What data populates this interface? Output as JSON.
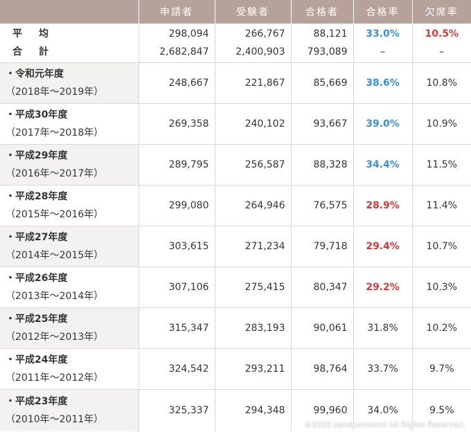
{
  "header": {
    "corner": "",
    "applicants": "申請者",
    "examinees": "受験者",
    "passers": "合格者",
    "pass_rate": "合格率",
    "absence_rate": "欠席率"
  },
  "summary": {
    "avg_label_a": "平",
    "avg_label_b": "均",
    "total_label_a": "合",
    "total_label_b": "計",
    "avg": {
      "applicants": "298,094",
      "examinees": "266,767",
      "passers": "88,121",
      "pass_rate": "33.0%",
      "absence_rate": "10.5%"
    },
    "total": {
      "applicants": "2,682,847",
      "examinees": "2,400,903",
      "passers": "793,089",
      "pass_rate": "–",
      "absence_rate": "–"
    }
  },
  "rows": [
    {
      "name": "・令和元年度",
      "range": "（2018年～2019年）",
      "applicants": "248,667",
      "examinees": "221,867",
      "passers": "85,669",
      "pass_rate": "38.6%",
      "rate_color": "blue",
      "absence_rate": "10.8%"
    },
    {
      "name": "・平成30年度",
      "range": "（2017年～2018年）",
      "applicants": "269,358",
      "examinees": "240,102",
      "passers": "93,667",
      "pass_rate": "39.0%",
      "rate_color": "blue",
      "absence_rate": "10.9%"
    },
    {
      "name": "・平成29年度",
      "range": "（2016年～2017年）",
      "applicants": "289,795",
      "examinees": "256,587",
      "passers": "88,328",
      "pass_rate": "34.4%",
      "rate_color": "blue",
      "absence_rate": "11.5%"
    },
    {
      "name": "・平成28年度",
      "range": "（2015年～2016年）",
      "applicants": "299,080",
      "examinees": "264,946",
      "passers": "76,575",
      "pass_rate": "28.9%",
      "rate_color": "red",
      "absence_rate": "11.4%"
    },
    {
      "name": "・平成27年度",
      "range": "（2014年～2015年）",
      "applicants": "303,615",
      "examinees": "271,234",
      "passers": "79,718",
      "pass_rate": "29.4%",
      "rate_color": "red",
      "absence_rate": "10.7%"
    },
    {
      "name": "・平成26年度",
      "range": "（2013年～2014年）",
      "applicants": "307,106",
      "examinees": "275,415",
      "passers": "80,347",
      "pass_rate": "29.2%",
      "rate_color": "red",
      "absence_rate": "10.3%"
    },
    {
      "name": "・平成25年度",
      "range": "（2012年～2013年）",
      "applicants": "315,347",
      "examinees": "283,193",
      "passers": "90,061",
      "pass_rate": "31.8%",
      "rate_color": "none",
      "absence_rate": "10.2%"
    },
    {
      "name": "・平成24年度",
      "range": "（2011年～2012年）",
      "applicants": "324,542",
      "examinees": "293,211",
      "passers": "98,764",
      "pass_rate": "33.7%",
      "rate_color": "none",
      "absence_rate": "9.7%"
    },
    {
      "name": "・平成23年度",
      "range": "（2010年～2011年）",
      "applicants": "325,337",
      "examinees": "294,348",
      "passers": "99,960",
      "pass_rate": "34.0%",
      "rate_color": "none",
      "absence_rate": "9.5%"
    }
  ],
  "colors": {
    "header_bg": "#b7a19b",
    "blue": "#3a8fd8",
    "red": "#d23a3a",
    "shade": "#f3f2f1"
  },
  "copyright": "©2020 sambunnoichi All Rights Reserved."
}
